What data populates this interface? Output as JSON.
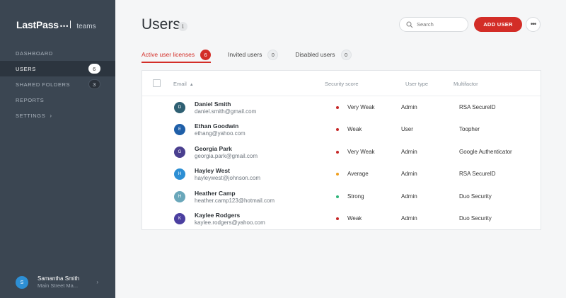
{
  "brand": {
    "name": "LastPass",
    "dots": "•••",
    "product": "teams"
  },
  "sidebar": {
    "items": [
      {
        "label": "DASHBOARD"
      },
      {
        "label": "USERS",
        "badge": "6"
      },
      {
        "label": "SHARED FOLDERS",
        "badge": "3"
      },
      {
        "label": "REPORTS"
      },
      {
        "label": "SETTINGS",
        "chevron": "›"
      }
    ],
    "user": {
      "initial": "S",
      "name": "Samantha Smith",
      "org": "Main Street Ma...",
      "chevron": "›"
    }
  },
  "header": {
    "title": "Users",
    "info_icon": "i",
    "search_placeholder": "Search",
    "add_user_label": "ADD USER",
    "more_icon": "•••"
  },
  "tabs": [
    {
      "label": "Active user licenses",
      "count": "6"
    },
    {
      "label": "Invited users",
      "count": "0"
    },
    {
      "label": "Disabled users",
      "count": "0"
    }
  ],
  "table": {
    "columns": {
      "email": "Email",
      "sort_icon": "▲",
      "security": "Security score",
      "type": "User type",
      "mfa": "Multifactor"
    },
    "rows": [
      {
        "initial": "D",
        "avatar_color": "#2f6073",
        "name": "Daniel Smith",
        "email": "daniel.smith@gmail.com",
        "score": "Very Weak",
        "score_color": "#c62828",
        "type": "Admin",
        "mfa": "RSA SecureID"
      },
      {
        "initial": "E",
        "avatar_color": "#1f5fa8",
        "name": "Ethan Goodwin",
        "email": "ethang@yahoo.com",
        "score": "Weak",
        "score_color": "#c62828",
        "type": "User",
        "mfa": "Toopher"
      },
      {
        "initial": "G",
        "avatar_color": "#4a3f8f",
        "name": "Georgia Park",
        "email": "georgia.park@gmail.com",
        "score": "Very Weak",
        "score_color": "#c62828",
        "type": "Admin",
        "mfa": "Google Authenticator"
      },
      {
        "initial": "H",
        "avatar_color": "#2d8fd4",
        "name": "Hayley West",
        "email": "hayleywest@johnson.com",
        "score": "Average",
        "score_color": "#f0a020",
        "type": "Admin",
        "mfa": "RSA SecureID"
      },
      {
        "initial": "H",
        "avatar_color": "#6aa7ba",
        "name": "Heather Camp",
        "email": "heather.camp123@hotmail.com",
        "score": "Strong",
        "score_color": "#2fb57a",
        "type": "Admin",
        "mfa": "Duo Security"
      },
      {
        "initial": "K",
        "avatar_color": "#4b3fa0",
        "name": "Kaylee Rodgers",
        "email": "kaylee.rodgers@yahoo.com",
        "score": "Weak",
        "score_color": "#c62828",
        "type": "Admin",
        "mfa": "Duo Security"
      }
    ]
  }
}
